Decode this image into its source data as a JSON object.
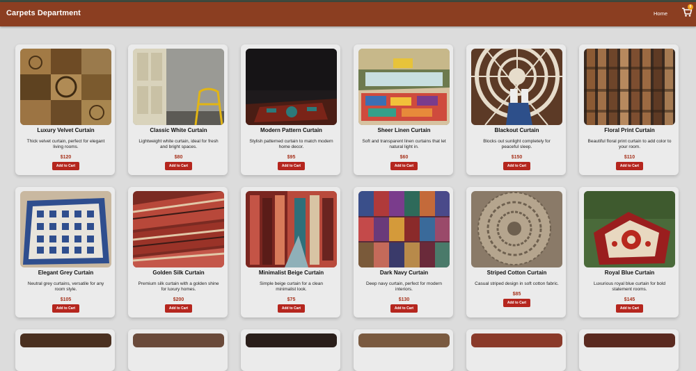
{
  "header": {
    "title": "Carpets Department",
    "home_label": "Home",
    "cart_count": "0"
  },
  "products": [
    {
      "title": "Luxury Velvet Curtain",
      "desc": "Thick velvet curtain, perfect for elegant living rooms.",
      "price": "$120",
      "button": "Add to Cart"
    },
    {
      "title": "Classic White Curtain",
      "desc": "Lightweight white curtain, ideal for fresh and bright spaces.",
      "price": "$80",
      "button": "Add to Cart"
    },
    {
      "title": "Modern Pattern Curtain",
      "desc": "Stylish patterned curtain to match modern home decor.",
      "price": "$95",
      "button": "Add to Cart"
    },
    {
      "title": "Sheer Linen Curtain",
      "desc": "Soft and transparent linen curtains that let natural light in.",
      "price": "$60",
      "button": "Add to Cart"
    },
    {
      "title": "Blackout Curtain",
      "desc": "Blocks out sunlight completely for peaceful sleep.",
      "price": "$150",
      "button": "Add to Cart"
    },
    {
      "title": "Floral Print Curtain",
      "desc": "Beautiful floral print curtain to add color to your room.",
      "price": "$110",
      "button": "Add to Cart"
    },
    {
      "title": "Elegant Grey Curtain",
      "desc": "Neutral grey curtains, versatile for any room style.",
      "price": "$105",
      "button": "Add to Cart"
    },
    {
      "title": "Golden Silk Curtain",
      "desc": "Premium silk curtain with a golden shine for luxury homes.",
      "price": "$200",
      "button": "Add to Cart"
    },
    {
      "title": "Minimalist Beige Curtain",
      "desc": "Simple beige curtain for a clean minimalist look.",
      "price": "$75",
      "button": "Add to Cart"
    },
    {
      "title": "Dark Navy Curtain",
      "desc": "Deep navy curtain, perfect for modern interiors.",
      "price": "$130",
      "button": "Add to Cart"
    },
    {
      "title": "Striped Cotton Curtain",
      "desc": "Casual striped design in soft cotton fabric.",
      "price": "$85",
      "button": "Add to Cart"
    },
    {
      "title": "Royal Blue Curtain",
      "desc": "Luxurious royal blue curtain for bold statement rooms.",
      "price": "$145",
      "button": "Add to Cart"
    }
  ],
  "colors": {
    "header_bg": "#8b3e21",
    "button_bg": "#b5261e",
    "price": "#a6321c",
    "page_bg": "#dcdcdc",
    "card_bg": "#ebebeb"
  },
  "icons": {
    "cart": "cart-icon"
  }
}
